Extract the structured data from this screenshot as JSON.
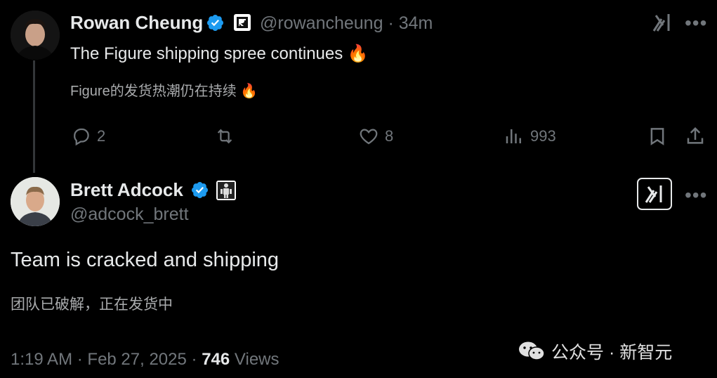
{
  "tweet1": {
    "author_name": "Rowan Cheung",
    "handle": "@rowancheung",
    "separator": "·",
    "time": "34m",
    "text": "The Figure shipping spree continues 🔥",
    "translation": "Figure的发货热潮仍在持续 🔥",
    "replies": "2",
    "likes": "8",
    "views": "993",
    "more": "•••"
  },
  "tweet2": {
    "author_name": "Brett Adcock",
    "handle": "@adcock_brett",
    "text": "Team is cracked and shipping",
    "translation": "团队已破解，正在发货中",
    "time": "1:19 AM",
    "dot": "·",
    "date": "Feb 27, 2025",
    "views_count": "746",
    "views_label": "Views",
    "more": "•••"
  },
  "watermark": {
    "text": "公众号 · 新智元"
  },
  "colors": {
    "background": "#000000",
    "text": "#e7e9ea",
    "muted": "#71767b",
    "verified": "#1d9bf0"
  }
}
